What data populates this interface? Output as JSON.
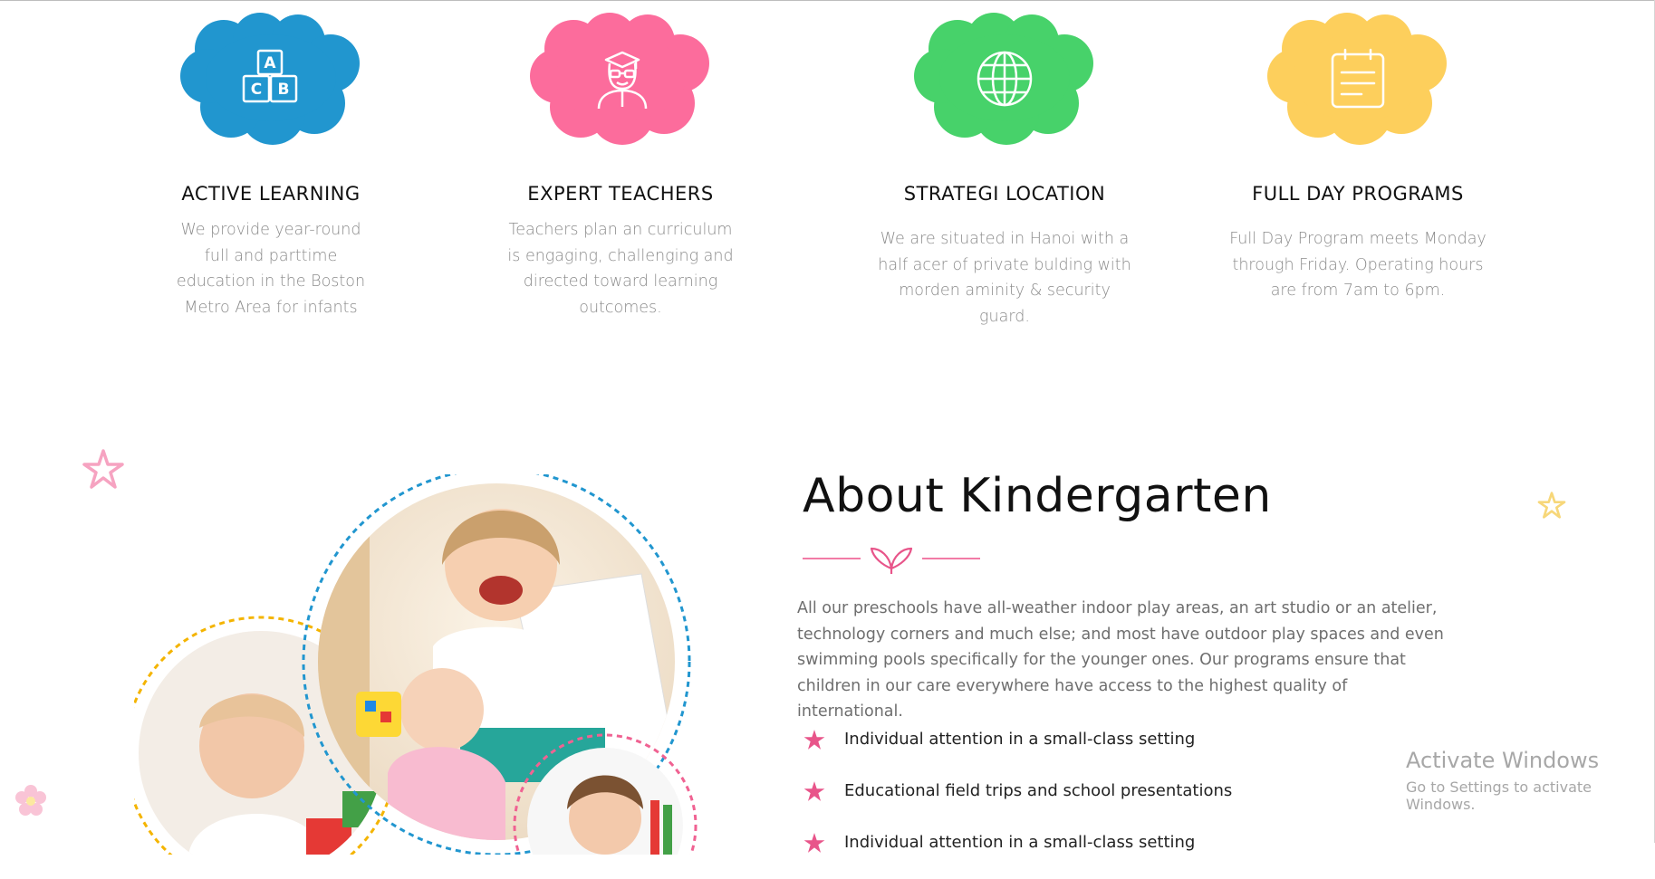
{
  "features": [
    {
      "title": "ACTIVE LEARNING",
      "text": "We provide year-round full and parttime education in the Boston Metro Area for infants",
      "color": "#2196CF",
      "icon": "abc-blocks-icon"
    },
    {
      "title": "EXPERT TEACHERS",
      "text": "Teachers plan an curriculum is engaging, challenging and directed toward learning outcomes.",
      "color": "#FC6C9C",
      "icon": "teacher-icon"
    },
    {
      "title": "STRATEGI LOCATION",
      "text": "We are situated in Hanoi with a half acer of private bulding with morden aminity & security guard.",
      "color": "#47D26A",
      "icon": "globe-icon"
    },
    {
      "title": "FULL DAY PROGRAMS",
      "text": "Full Day Program meets Monday through Friday. Operating hours are from 7am to 6pm.",
      "color": "#FDCF5C",
      "icon": "calendar-icon"
    }
  ],
  "about": {
    "title": "About Kindergarten",
    "paragraph": "All our preschools have all-weather indoor play areas, an art studio or an atelier, technology corners and much else; and most have outdoor play spaces and even swimming pools specifically for the younger ones. Our programs ensure that children in our care everywhere have access to the highest quality of international.",
    "bullets": [
      "Individual attention in a small-class setting",
      "Educational field trips and school presentations",
      "Individual attention in a small-class setting"
    ],
    "accent": "#E8558A"
  },
  "watermark": {
    "line1": "Activate Windows",
    "line2": "Go to Settings to activate Windows."
  }
}
